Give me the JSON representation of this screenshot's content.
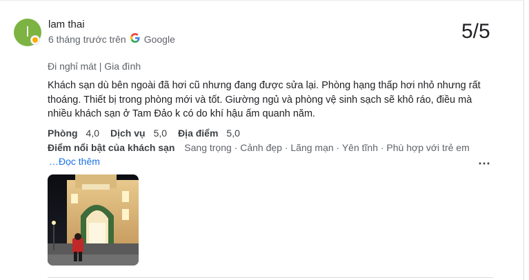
{
  "review": {
    "author": "lam thai",
    "avatar_initial": "l",
    "time": "6 tháng trước trên",
    "source": "Google",
    "score": "5/5",
    "trip": "Đi nghỉ mát | Gia đình",
    "text": "Khách sạn dù bên ngoài đã hơi cũ nhưng đang được sửa lại. Phòng hạng thấp hơi nhỏ nhưng rất thoáng. Thiết bị trong phòng mới và tốt. Giường ngủ và phòng vệ sinh sạch sẽ khô ráo, điều mà nhiều khách sạn ở Tam Đảo k có do khí hậu ấm quanh năm.",
    "ratings": [
      {
        "label": "Phòng",
        "value": "4,0"
      },
      {
        "label": "Dịch vụ",
        "value": "5,0"
      },
      {
        "label": "Địa điểm",
        "value": "5,0"
      }
    ],
    "highlights_label": "Điểm nổi bật của khách sạn",
    "highlights": "Sang trọng · Cảnh đẹp · Lãng mạn · Yên tĩnh · Phù hợp với trẻ em",
    "read_more": "…Đọc thêm",
    "more_icon": "⋯",
    "google_icon": "G"
  },
  "colors": {
    "avatar_bg": "#7cb342",
    "link": "#1a73e8",
    "google_blue": "#4285f4"
  }
}
